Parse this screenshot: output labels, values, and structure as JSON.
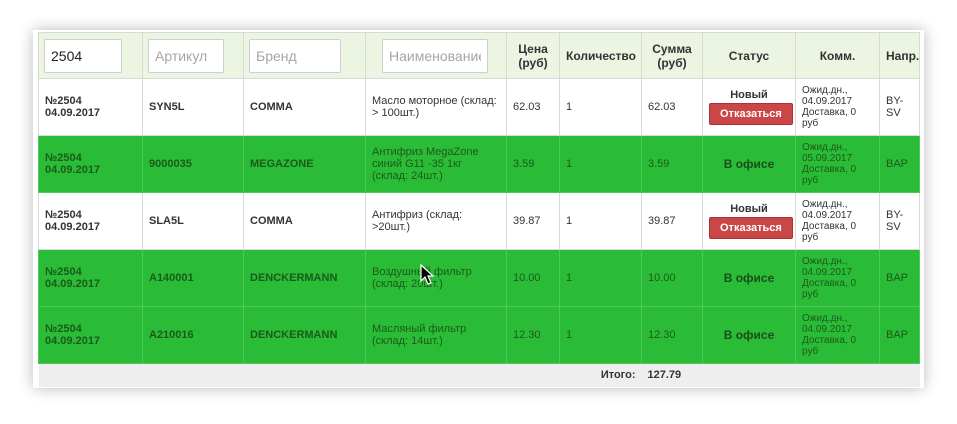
{
  "filters": {
    "number": {
      "value": "2504",
      "placeholder": ""
    },
    "article": {
      "value": "",
      "placeholder": "Артикул"
    },
    "brand": {
      "value": "",
      "placeholder": "Бренд"
    },
    "name": {
      "value": "",
      "placeholder": "Наименование"
    }
  },
  "columns": {
    "price_line1": "Цена",
    "price_line2": "(руб)",
    "quantity": "Количество",
    "sum_line1": "Сумма",
    "sum_line2": "(руб)",
    "status": "Статус",
    "comment": "Комм.",
    "direction": "Напр."
  },
  "rows": [
    {
      "number": "№2504",
      "date": "04.09.2017",
      "article": "SYN5L",
      "brand": "COMMA",
      "name": "Масло моторное (склад: > 100шт.)",
      "price": "62.03",
      "qty": "1",
      "sum": "62.03",
      "status": "Новый",
      "action": "Отказаться",
      "comment": "Ожид.дн., 04.09.2017 Доставка, 0 руб",
      "direction": "BY-SV",
      "row_color": "white"
    },
    {
      "number": "№2504",
      "date": "04.09.2017",
      "article": "9000035",
      "brand": "MEGAZONE",
      "name": "Антифриз MegaZone синий G11 -35 1кг (склад: 24шт.)",
      "price": "3.59",
      "qty": "1",
      "sum": "3.59",
      "status": "В офисе",
      "action": "",
      "comment": "Ожид.дн., 05.09.2017 Доставка, 0 руб",
      "direction": "BAP",
      "row_color": "green"
    },
    {
      "number": "№2504",
      "date": "04.09.2017",
      "article": "SLA5L",
      "brand": "COMMA",
      "name": "Антифриз (склад: >20шт.)",
      "price": "39.87",
      "qty": "1",
      "sum": "39.87",
      "status": "Новый",
      "action": "Отказаться",
      "comment": "Ожид.дн., 04.09.2017 Доставка, 0 руб",
      "direction": "BY-SV",
      "row_color": "white"
    },
    {
      "number": "№2504",
      "date": "04.09.2017",
      "article": "A140001",
      "brand": "DENCKERMANN",
      "name": "Воздушный фильтр (склад: 20шт.)",
      "price": "10.00",
      "qty": "1",
      "sum": "10.00",
      "status": "В офисе",
      "action": "",
      "comment": "Ожид.дн., 04.09.2017 Доставка, 0 руб",
      "direction": "BAP",
      "row_color": "green"
    },
    {
      "number": "№2504",
      "date": "04.09.2017",
      "article": "A210016",
      "brand": "DENCKERMANN",
      "name": "Масляный фильтр (склад: 14шт.)",
      "price": "12.30",
      "qty": "1",
      "sum": "12.30",
      "status": "В офисе",
      "action": "",
      "comment": "Ожид.дн., 04.09.2017 Доставка, 0 руб",
      "direction": "BAP",
      "row_color": "green"
    }
  ],
  "footer": {
    "total_label": "Итого:",
    "total_value": "127.79"
  },
  "colors": {
    "green_row": "#2bbc37",
    "header_bg": "#ebf5e1",
    "refuse_button": "#cb4646"
  }
}
